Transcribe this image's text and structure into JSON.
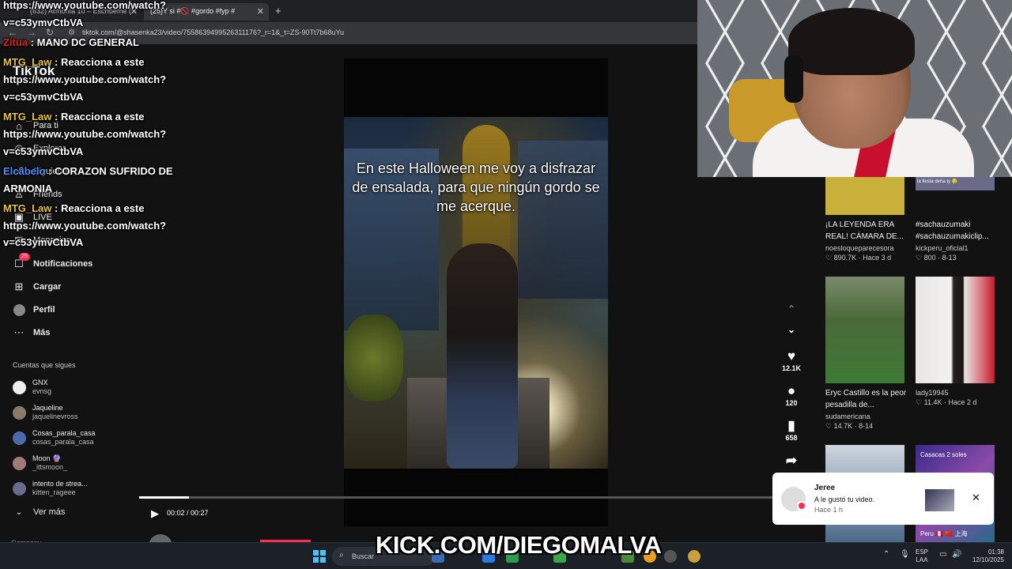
{
  "browser": {
    "tabs": [
      {
        "label": "(632) Armonía 10 – Escríbeme (",
        "active": false
      },
      {
        "label": "(25)Y si #🚫 #gordo #fyp #",
        "active": true
      }
    ],
    "new_tab": "+",
    "url": "tiktok.com/@shasenka23/video/7558639499526311176?_r=1&_t=ZS-90Tt7b68uYu"
  },
  "sidebar": {
    "logo": "TikTok",
    "nav": [
      {
        "label": "Para ti",
        "icon": "home-icon"
      },
      {
        "label": "Explorar",
        "icon": "compass-icon"
      },
      {
        "label": "Siguiendo",
        "icon": "following-icon"
      },
      {
        "label": "Friends",
        "icon": "friends-icon"
      },
      {
        "label": "LIVE",
        "icon": "live-icon"
      },
      {
        "label": "Mensajes",
        "icon": "messages-icon"
      },
      {
        "label": "Notificaciones",
        "icon": "inbox-icon",
        "badge": "25"
      },
      {
        "label": "Cargar",
        "icon": "upload-icon"
      },
      {
        "label": "Perfil",
        "icon": "profile-icon"
      },
      {
        "label": "Más",
        "icon": "more-icon"
      }
    ],
    "following_title": "Cuentas que sigues",
    "following": [
      {
        "name": "GNX",
        "user": "evnsg"
      },
      {
        "name": "Jaqueline",
        "user": "jaquelinevross"
      },
      {
        "name": "Cosas_parala_casa",
        "user": "cosas_parala_casa"
      },
      {
        "name": "Moon 🔮",
        "user": "_ittsmoon_"
      },
      {
        "name": "intento de strea...",
        "user": "kitten_rageee"
      }
    ],
    "see_more": "Ver más",
    "company": "Company"
  },
  "player": {
    "caption": "En este Halloween me voy a disfrazar de ensalada, para que ningún gordo se me acerque.",
    "time": "00:02 / 00:27",
    "progress": 0.074,
    "author": "shasenka23"
  },
  "actions": {
    "likes": "12.1K",
    "comments": "120",
    "saves": "658"
  },
  "feed": [
    {
      "title": "¡LA LEYENDA ERA REAL! CÁMARA DE...",
      "user": "noesloqueparecesora",
      "meta": "♡ 890.7K · Hace 3 d"
    },
    {
      "title": "#sachauzumaki #sachauzumakiclip...",
      "user": "kickperu_oficial1",
      "meta": "♡ 800 · 8-13"
    },
    {
      "title": "Eryc Castillo es la peor pesadilla de...",
      "user": "sudamericana",
      "meta": "♡ 14.7K · 8-14"
    },
    {
      "title": "",
      "user": "lady19945",
      "meta": "♡ 11.4K · Hace 2 d"
    }
  ],
  "feed_overlays": {
    "top_right": "la fiesta deña ty 😏",
    "bottom_right": "Casacas 2 soles",
    "bottom_right_2": "Peru 🇵🇪 🇨🇳 上海"
  },
  "notification": {
    "name": "Jeree",
    "message": "A le gustó tu video.",
    "time": "Hace 1 h"
  },
  "chat": [
    {
      "user": "",
      "text": "https://www.youtube.com/watch?",
      "color": "#ffffff"
    },
    {
      "user": "",
      "text": "v=c53ymvCtbVA",
      "color": "#ffffff"
    },
    {
      "user": "Zitua",
      "text": " : MANO DC GENERAL",
      "color": "#e02020"
    },
    {
      "user": "MTG_Law",
      "text": " : Reacciona a este",
      "color": "#e8c23a"
    },
    {
      "user": "",
      "text": "https://www.youtube.com/watch?",
      "color": "#ffffff"
    },
    {
      "user": "",
      "text": "v=c53ymvCtbVA",
      "color": "#ffffff"
    },
    {
      "user": "MTG_Law",
      "text": " : Reacciona a este",
      "color": "#e8c23a"
    },
    {
      "user": "",
      "text": "https://www.youtube.com/watch?",
      "color": "#ffffff"
    },
    {
      "user": "",
      "text": "v=c53ymvCtbVA",
      "color": "#ffffff"
    },
    {
      "user": "Elcabelo",
      "text": " : CORAZON SUFRIDO DE",
      "color": "#4a8cff"
    },
    {
      "user": "",
      "text": "ARMONIA",
      "color": "#ffffff"
    },
    {
      "user": "MTG_Law",
      "text": " : Reacciona a este",
      "color": "#e8c23a"
    },
    {
      "user": "",
      "text": "https://www.youtube.com/watch?",
      "color": "#ffffff"
    },
    {
      "user": "",
      "text": "v=c53ymvCtbVA",
      "color": "#ffffff"
    }
  ],
  "stream_overlay": "KICK.COM/DIEGOMALVA",
  "taskbar": {
    "search": "Buscar",
    "lang": "ESP",
    "lang2": "LAA",
    "time": "01:38",
    "date": "12/10/2025"
  }
}
